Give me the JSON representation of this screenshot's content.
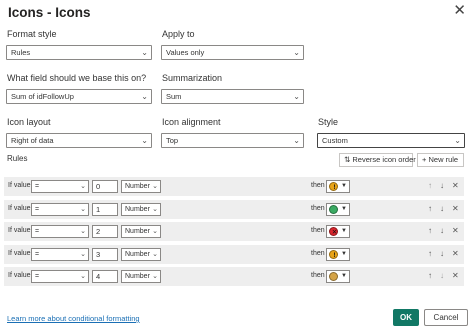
{
  "dialog": {
    "title": "Icons - Icons"
  },
  "format_style": {
    "label": "Format style",
    "value": "Rules"
  },
  "apply_to": {
    "label": "Apply to",
    "value": "Values only"
  },
  "base_field": {
    "label": "What field should we base this on?",
    "value": "Sum of idFollowUp"
  },
  "summarization": {
    "label": "Summarization",
    "value": "Sum"
  },
  "icon_layout": {
    "label": "Icon layout",
    "value": "Right of data"
  },
  "icon_alignment": {
    "label": "Icon alignment",
    "value": "Top"
  },
  "style": {
    "label": "Style",
    "value": "Custom"
  },
  "rules": {
    "label": "Rules",
    "reverse_label": "Reverse icon order",
    "new_rule_label": "New rule",
    "rows": [
      {
        "if_label": "If value",
        "operator": "=",
        "value": "0",
        "type": "Number",
        "then_label": "then",
        "icon_color": "#e8a317",
        "icon_mark": "!"
      },
      {
        "if_label": "If value",
        "operator": "=",
        "value": "1",
        "type": "Number",
        "then_label": "then",
        "icon_color": "#3aaa62",
        "icon_mark": ""
      },
      {
        "if_label": "If value",
        "operator": "=",
        "value": "2",
        "type": "Number",
        "then_label": "then",
        "icon_color": "#d9252c",
        "icon_mark": "✕"
      },
      {
        "if_label": "If value",
        "operator": "=",
        "value": "3",
        "type": "Number",
        "then_label": "then",
        "icon_color": "#e8a317",
        "icon_mark": "!"
      },
      {
        "if_label": "If value",
        "operator": "=",
        "value": "4",
        "type": "Number",
        "then_label": "then",
        "icon_color": "#d4a347",
        "icon_mark": ""
      }
    ]
  },
  "footer": {
    "link": "Learn more about conditional formatting",
    "ok_label": "OK",
    "cancel_label": "Cancel"
  },
  "colors": {
    "accent": "#117865",
    "link": "#1a6fb5",
    "row_bg": "#eeeeee"
  }
}
